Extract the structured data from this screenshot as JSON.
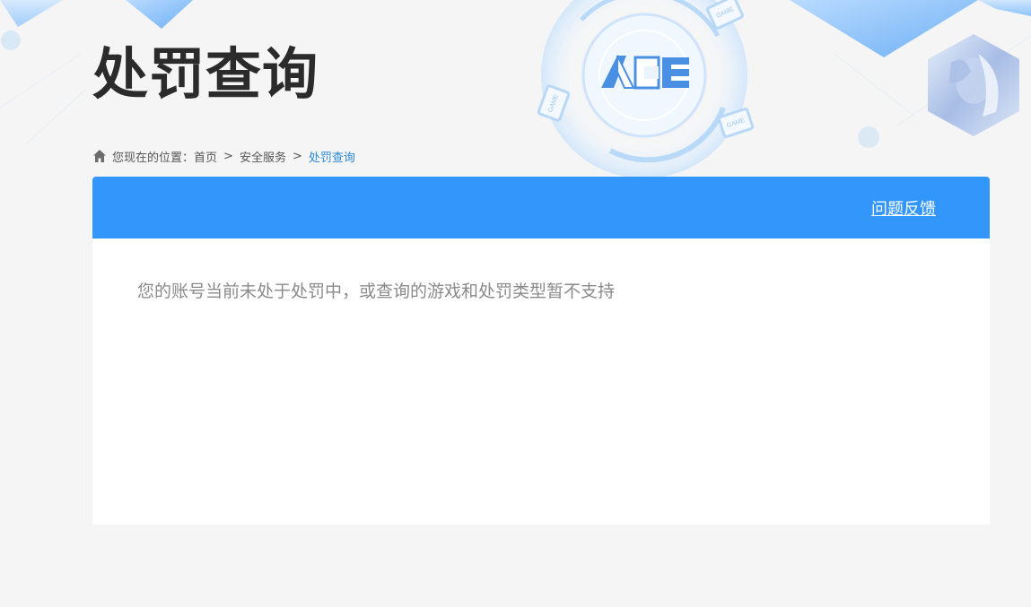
{
  "page": {
    "title": "处罚查询"
  },
  "breadcrumb": {
    "prefix": "您现在的位置：",
    "items": [
      "首页",
      "安全服务"
    ],
    "separator": ">",
    "current": "处罚查询"
  },
  "header": {
    "feedback_label": "问题反馈"
  },
  "result": {
    "message": "您的账号当前未处于处罚中，或查询的游戏和处罚类型暂不支持"
  },
  "logo": {
    "text": "ACE",
    "badge_text": "GAME"
  },
  "colors": {
    "accent": "#3396fa",
    "breadcrumb_current": "#2a87d8",
    "background": "#f5f5f5"
  }
}
